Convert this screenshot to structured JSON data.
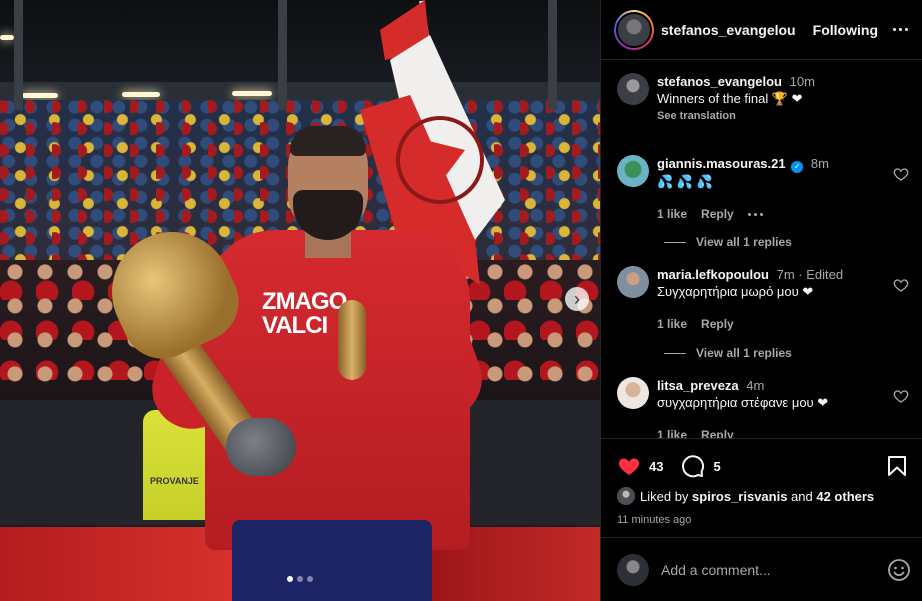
{
  "post": {
    "image_count": 3,
    "active_image": 1,
    "jersey_text": "ZMAGO VALCI",
    "steward_vest_text": "PROVANJE"
  },
  "header": {
    "username": "stefanos_evangelou",
    "follow_label": "Following"
  },
  "caption": {
    "username": "stefanos_evangelou",
    "time": "10m",
    "text": "Winners of the final 🏆 ❤",
    "see_translation": "See translation"
  },
  "comments": [
    {
      "username": "giannis.masouras.21",
      "verified": true,
      "verified_mark": "✓",
      "time": "8m",
      "edited": "",
      "text": "💦 💦 💦",
      "likes": "1 like",
      "reply": "Reply",
      "view_replies": "View all 1 replies"
    },
    {
      "username": "maria.lefkopoulou",
      "time": "7m",
      "edited": "· Edited",
      "text": "Συγχαρητήρια μωρό μου ❤",
      "likes": "1 like",
      "reply": "Reply",
      "view_replies": "View all 1 replies"
    },
    {
      "username": "litsa_preveza",
      "time": "4m",
      "edited": "",
      "text": "συγχαρητήρια στέφανε μου ❤",
      "likes": "1 like",
      "reply": "Reply"
    }
  ],
  "actions": {
    "like_count": "43",
    "comment_count": "5"
  },
  "liked_by": {
    "prefix": "Liked by ",
    "user": "spiros_risvanis",
    "middle": " and ",
    "others": "42 others"
  },
  "posted_time": "11 minutes ago",
  "add_comment": {
    "placeholder": "Add a comment..."
  },
  "colors": {
    "like_red": "#ff3040",
    "verified_blue": "#0095f6",
    "background": "#000000",
    "secondary_text": "#a8a8a8"
  }
}
